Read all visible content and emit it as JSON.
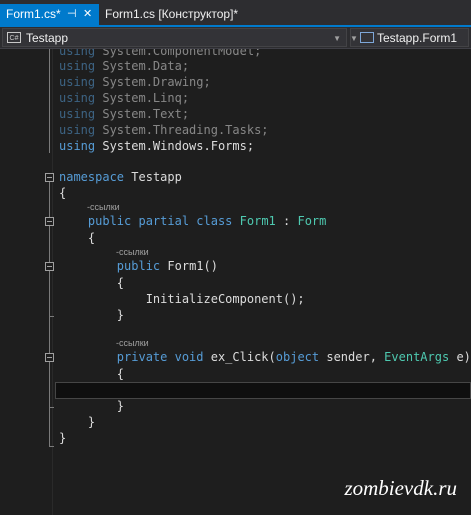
{
  "tabs": [
    {
      "label": "Form1.cs*",
      "pin_icon": "⊣",
      "close_icon": "✕",
      "active": true
    },
    {
      "label": "Form1.cs [Конструктор]*",
      "active": false
    }
  ],
  "navbar": {
    "project_icon": "C#",
    "project": "Testapp",
    "class_icon": "cls",
    "class": "Testapp.Form1"
  },
  "code": {
    "using_lines": [
      {
        "kw": "using",
        "ns": "System.ComponentModel;"
      },
      {
        "kw": "using",
        "ns": "System.Data;"
      },
      {
        "kw": "using",
        "ns": "System.Drawing;"
      },
      {
        "kw": "using",
        "ns": "System.Linq;"
      },
      {
        "kw": "using",
        "ns": "System.Text;"
      },
      {
        "kw": "using",
        "ns": "System.Threading.Tasks;"
      },
      {
        "kw": "using",
        "ns": "System.Windows.Forms;"
      }
    ],
    "namespace_kw": "namespace",
    "namespace_name": "Testapp",
    "codelens": "-ссылки",
    "class_mods": "public partial class",
    "class_name": "Form1",
    "class_sep": ":",
    "class_base": "Form",
    "ctor_kw": "public",
    "ctor_sig": "Form1()",
    "ctor_body": "InitializeComponent();",
    "method_kw": "private void",
    "method_name": "ex_Click(",
    "param1_type": "object",
    "param1_name": "sender,",
    "param2_type": "EventArgs",
    "param2_name": "e)",
    "open_brace": "{",
    "close_brace": "}"
  },
  "watermark": "zombievdk.ru",
  "colors": {
    "keyword": "#569cd6",
    "type": "#4ec9b0",
    "text": "#dcdcdc",
    "accent": "#007acc"
  }
}
